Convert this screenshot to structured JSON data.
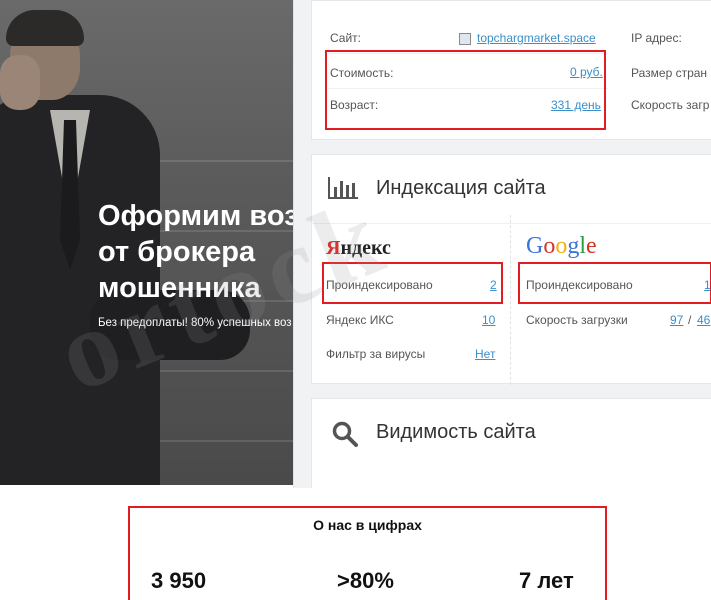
{
  "hero": {
    "title_line1": "Оформим воз",
    "title_line2": "от брокера",
    "title_line3": "мошенника",
    "subtitle": "Без предоплаты! 80% успешных воз"
  },
  "site_card": {
    "site_label": "Сайт:",
    "site_value": "topchargmarket.space",
    "cost_label": "Стоимость:",
    "cost_value": "0 руб.",
    "age_label": "Возраст:",
    "age_value": "331 день",
    "ip_label": "IP адрес:",
    "page_size_label": "Размер стран",
    "speed_label": "Скорость загр"
  },
  "indexing_card": {
    "title": "Индексация сайта",
    "yandex_logo": "Яндекс",
    "yandex_indexed_label": "Проиндексировано",
    "yandex_indexed_value": "2",
    "yandex_iks_label": "Яндекс ИКС",
    "yandex_iks_value": "10",
    "virus_filter_label": "Фильтр за вирусы",
    "virus_filter_value": "Нет",
    "google_logo": "Google",
    "google_indexed_label": "Проиндексировано",
    "google_indexed_value": "1",
    "load_speed_label": "Скорость загрузки",
    "load_speed_value1": "97",
    "load_speed_sep": "/",
    "load_speed_value2": "46"
  },
  "visibility_card": {
    "title": "Видимость сайта"
  },
  "stats": {
    "title": "О нас в цифрах",
    "stat1": "3 950",
    "stat2": ">80%",
    "stat3": "7 лет"
  },
  "watermark": "ortock",
  "colors": {
    "highlight_red": "#e31b23",
    "link_blue": "#3a8fc8"
  },
  "icons": [
    "bar-chart-icon",
    "search-icon",
    "site-favicon-icon"
  ]
}
